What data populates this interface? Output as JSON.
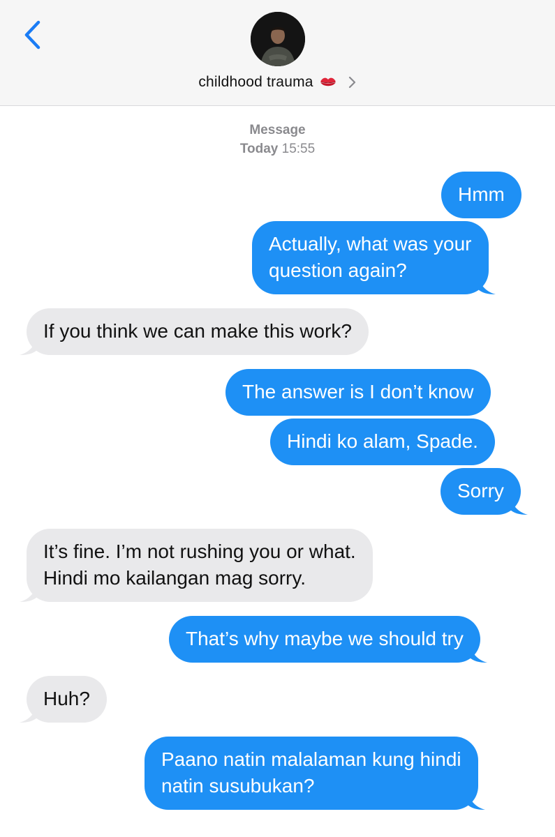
{
  "header": {
    "contact_name": "childhood trauma",
    "back_icon": "chevron-left-icon",
    "emoji_icon": "kiss-mark-icon",
    "disclosure_icon": "chevron-right-icon"
  },
  "thread": {
    "service_label": "Message",
    "date_label": "Today",
    "time_label": "15:55"
  },
  "messages": [
    {
      "direction": "sent",
      "lines": [
        "Hmm"
      ]
    },
    {
      "direction": "sent",
      "lines": [
        "Actually, what was your",
        "question again?"
      ]
    },
    {
      "direction": "received",
      "lines": [
        "If you think we can make this work?"
      ]
    },
    {
      "direction": "sent",
      "lines": [
        "The answer is I don’t know"
      ]
    },
    {
      "direction": "sent",
      "lines": [
        "Hindi ko alam, Spade."
      ]
    },
    {
      "direction": "sent",
      "lines": [
        "Sorry"
      ]
    },
    {
      "direction": "received",
      "lines": [
        "It’s fine. I’m not rushing you or what.",
        "Hindi mo kailangan mag sorry."
      ]
    },
    {
      "direction": "sent",
      "lines": [
        "That’s why maybe we should try"
      ]
    },
    {
      "direction": "received",
      "lines": [
        "Huh?"
      ]
    },
    {
      "direction": "sent",
      "lines": [
        "Paano natin malalaman kung hindi",
        "natin susubukan?"
      ]
    }
  ],
  "colors": {
    "sent_bubble": "#1e90f5",
    "received_bubble": "#e9e9eb",
    "accent": "#1a7cf5"
  }
}
